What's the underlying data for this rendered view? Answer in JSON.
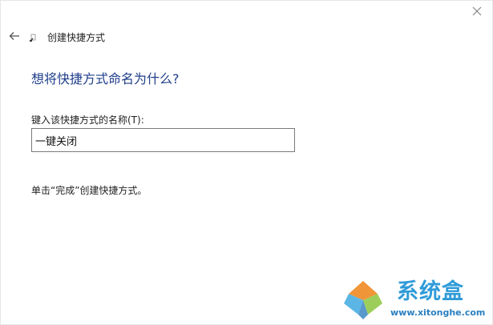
{
  "wizard": {
    "title": "创建快捷方式",
    "heading": "想将快捷方式命名为什么?",
    "field_label": "键入该快捷方式的名称(T):",
    "name_value": "一键关闭",
    "instruction": "单击“完成”创建快捷方式。"
  },
  "watermark": {
    "brand": "系统盒",
    "url": "www.xitonghe.com"
  },
  "icons": {
    "close": "close-icon",
    "back": "back-arrow-icon",
    "wizard": "shortcut-wizard-icon",
    "logo": "watermark-logo-icon"
  },
  "colors": {
    "heading": "#1f3e8a",
    "watermark_brand": "#2f9bd8",
    "watermark_url": "#2a7fc0"
  }
}
